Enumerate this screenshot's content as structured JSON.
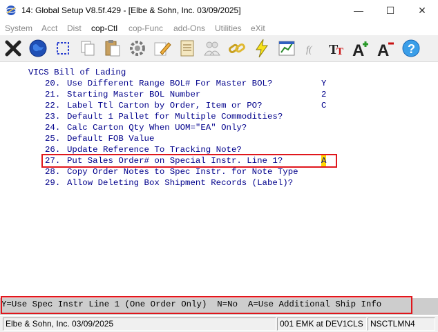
{
  "window": {
    "title": "14: Global Setup V8.5f.429 - [Elbe & Sohn, Inc. 03/09/2025]",
    "minimize_glyph": "—",
    "maximize_glyph": "☐",
    "close_glyph": "✕"
  },
  "menu": {
    "items": [
      {
        "label": "System"
      },
      {
        "label": "Acct"
      },
      {
        "label": "Dist"
      },
      {
        "label": "cop-Ctl"
      },
      {
        "label": "cop-Func"
      },
      {
        "label": "add-Ons"
      },
      {
        "label": "Utilities"
      },
      {
        "label": "eXit"
      }
    ]
  },
  "toolbar": {
    "icons": [
      "close-icon",
      "globe-icon",
      "select-icon",
      "copy-icon",
      "paste-icon",
      "settings-icon",
      "edit-icon",
      "list-icon",
      "users-icon",
      "chain-icon",
      "lightning-icon",
      "chart-icon",
      "script-icon",
      "font-icon",
      "font-larger-icon",
      "font-smaller-icon",
      "help-icon"
    ]
  },
  "screen": {
    "section_title": "VICS Bill of Lading",
    "lines": [
      {
        "num": "20.",
        "text": "Use Different Range BOL# For Master BOL?",
        "value": "Y"
      },
      {
        "num": "21.",
        "text": "Starting Master BOL Number",
        "value": "2"
      },
      {
        "num": "22.",
        "text": "Label Ttl Carton by Order, Item or PO?",
        "value": "C"
      },
      {
        "num": "23.",
        "text": "Default 1 Pallet for Multiple Commodities?",
        "value": ""
      },
      {
        "num": "24.",
        "text": "Calc Carton Qty When UOM=\"EA\" Only?",
        "value": ""
      },
      {
        "num": "25.",
        "text": "Default FOB Value",
        "value": ""
      },
      {
        "num": "26.",
        "text": "Update Reference To Tracking Note?",
        "value": ""
      },
      {
        "num": "27.",
        "text": "Put Sales Order# on Special Instr. Line 1?",
        "value": "A"
      },
      {
        "num": "28.",
        "text": "Copy Order Notes to Spec Instr. for Note Type",
        "value": ""
      },
      {
        "num": "29.",
        "text": "Allow Deleting Box Shipment Records (Label)?",
        "value": ""
      }
    ]
  },
  "help": {
    "text": "Y=Use Spec Instr Line 1 (One Order Only)  N=No  A=Use Additional Ship Info"
  },
  "status": {
    "company": "Elbe & Sohn, Inc. 03/09/2025",
    "session": "001 EMK at DEV1CLS",
    "terminal": "NSCTLMN4"
  },
  "colors": {
    "screen_text": "#00008b",
    "highlight_border": "#e0161c",
    "cursor_bg": "#ffd700"
  }
}
